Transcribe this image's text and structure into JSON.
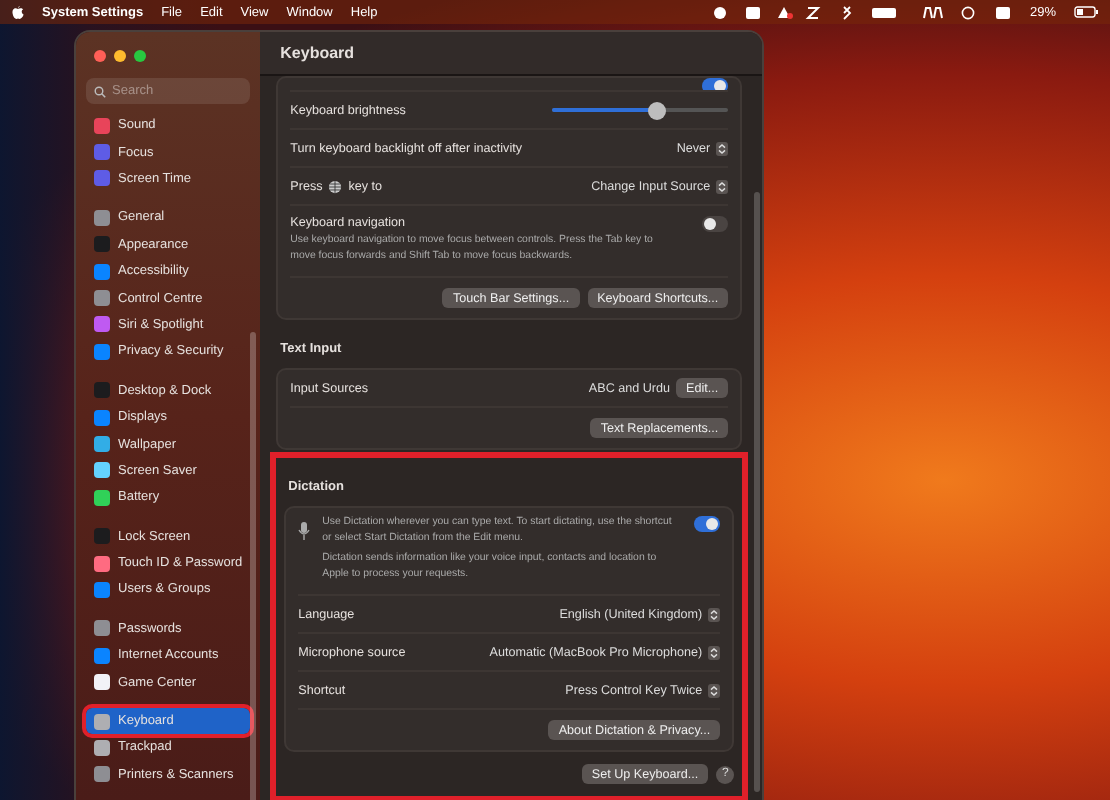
{
  "menubar": {
    "app": "System Settings",
    "menus": [
      "File",
      "Edit",
      "View",
      "Window",
      "Help"
    ],
    "battery": "29%"
  },
  "sidebar": {
    "search": {
      "placeholder": "Search"
    },
    "groups": [
      {
        "items": [
          {
            "label": "Sound",
            "color": "#e8445a",
            "selected": false,
            "highlighted": false
          },
          {
            "label": "Focus",
            "color": "#5e5ce6",
            "selected": false,
            "highlighted": false
          },
          {
            "label": "Screen Time",
            "color": "#5e5ce6",
            "selected": false,
            "highlighted": false
          }
        ]
      },
      {
        "items": [
          {
            "label": "General",
            "color": "#8e8e93",
            "selected": false,
            "highlighted": false
          },
          {
            "label": "Appearance",
            "color": "#1c1c1e",
            "selected": false,
            "highlighted": false
          },
          {
            "label": "Accessibility",
            "color": "#0a84ff",
            "selected": false,
            "highlighted": false
          },
          {
            "label": "Control Centre",
            "color": "#8e8e93",
            "selected": false,
            "highlighted": false
          },
          {
            "label": "Siri & Spotlight",
            "color": "#bf5af2",
            "selected": false,
            "highlighted": false
          },
          {
            "label": "Privacy & Security",
            "color": "#0a84ff",
            "selected": false,
            "highlighted": false
          }
        ]
      },
      {
        "items": [
          {
            "label": "Desktop & Dock",
            "color": "#1c1c1e",
            "selected": false,
            "highlighted": false
          },
          {
            "label": "Displays",
            "color": "#0a84ff",
            "selected": false,
            "highlighted": false
          },
          {
            "label": "Wallpaper",
            "color": "#32ade6",
            "selected": false,
            "highlighted": false
          },
          {
            "label": "Screen Saver",
            "color": "#64d2ff",
            "selected": false,
            "highlighted": false
          },
          {
            "label": "Battery",
            "color": "#30d158",
            "selected": false,
            "highlighted": false
          }
        ]
      },
      {
        "items": [
          {
            "label": "Lock Screen",
            "color": "#1c1c1e",
            "selected": false,
            "highlighted": false
          },
          {
            "label": "Touch ID & Password",
            "color": "#ff6b81",
            "selected": false,
            "highlighted": false
          },
          {
            "label": "Users & Groups",
            "color": "#0a84ff",
            "selected": false,
            "highlighted": false
          }
        ]
      },
      {
        "items": [
          {
            "label": "Passwords",
            "color": "#8e8e93",
            "selected": false,
            "highlighted": false
          },
          {
            "label": "Internet Accounts",
            "color": "#0a84ff",
            "selected": false,
            "highlighted": false
          },
          {
            "label": "Game Center",
            "color": "#f2f2f7",
            "selected": false,
            "highlighted": false
          }
        ]
      },
      {
        "items": [
          {
            "label": "Keyboard",
            "color": "#aeaeb2",
            "selected": true,
            "highlighted": true
          },
          {
            "label": "Trackpad",
            "color": "#aeaeb2",
            "selected": false,
            "highlighted": false
          },
          {
            "label": "Printers & Scanners",
            "color": "#8e8e93",
            "selected": false,
            "highlighted": false
          }
        ]
      }
    ]
  },
  "main": {
    "title": "Keyboard",
    "sections": [
      {
        "rows": [
          {
            "kind": "cut-toggle",
            "on": true
          },
          {
            "kind": "slider",
            "label": "Keyboard brightness",
            "level": 0.6
          },
          {
            "kind": "select",
            "label": "Turn keyboard backlight off after inactivity",
            "value": "Never"
          },
          {
            "kind": "key-select",
            "label_before": "Press",
            "label_after": "key to",
            "value": "Change Input Source"
          },
          {
            "kind": "toggle",
            "label": "Keyboard navigation",
            "description": [
              "Use keyboard navigation to move focus between controls. Press the Tab key to move focus forwards and Shift Tab to move focus backwards."
            ],
            "on": false
          },
          {
            "kind": "buttons",
            "buttons": [
              "Touch Bar Settings...",
              "Keyboard Shortcuts..."
            ]
          }
        ]
      },
      {
        "heading": "Text Input",
        "rows": [
          {
            "kind": "value-button",
            "label": "Input Sources",
            "value": "ABC and Urdu",
            "button": "Edit..."
          },
          {
            "kind": "buttons",
            "buttons": [
              "Text Replacements..."
            ]
          }
        ]
      },
      {
        "heading": "Dictation",
        "highlighted": true,
        "rows": [
          {
            "kind": "dictation",
            "description": [
              "Use Dictation wherever you can type text. To start dictating, use the shortcut or select Start Dictation from the Edit menu.",
              "Dictation sends information like your voice input, contacts and location to Apple to process your requests."
            ],
            "on": true
          },
          {
            "kind": "select",
            "label": "Language",
            "value": "English (United Kingdom)"
          },
          {
            "kind": "select",
            "label": "Microphone source",
            "value": "Automatic (MacBook Pro Microphone)"
          },
          {
            "kind": "select",
            "label": "Shortcut",
            "value": "Press Control Key Twice"
          },
          {
            "kind": "buttons",
            "buttons": [
              "About Dictation & Privacy..."
            ]
          }
        ],
        "footer": {
          "buttons": [
            "Set Up Keyboard..."
          ],
          "help": "?"
        }
      }
    ]
  }
}
